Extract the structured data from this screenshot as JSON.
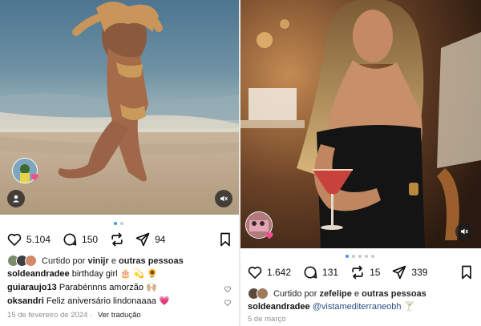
{
  "left_post": {
    "counts": {
      "likes": "5.104",
      "comments": "150",
      "shares": "94"
    },
    "liked_by": {
      "prefix": "Curtido por",
      "user": "vinijr",
      "conj": "e",
      "others": "outras pessoas"
    },
    "caption": {
      "user": "soldeandradee",
      "text": "birthday girl 🎂 💫 🌻"
    },
    "comments": [
      {
        "user": "guiaraujo13",
        "text": "Parabénnns amorzão 🙌🏼"
      },
      {
        "user": "oksandri",
        "text": "Feliz aniversário lindonaaaa 💗"
      }
    ],
    "date": "15 de fevereiro de 2024",
    "separator": "·",
    "translate": "Ver tradução"
  },
  "right_post": {
    "counts": {
      "likes": "1.642",
      "comments": "131",
      "reposts": "15",
      "shares": "339"
    },
    "liked_by": {
      "prefix": "Curtido por",
      "user": "zefelipe",
      "conj": "e",
      "others": "outras pessoas"
    },
    "caption": {
      "user": "soldeandradee",
      "mention": "@vistamediterraneobh",
      "emoji": "🍸"
    },
    "date": "5 de março"
  },
  "colors": {
    "accent_blue": "#3897f0",
    "mention": "#2b4f85",
    "meta_gray": "#8e8e8e"
  },
  "icons": [
    "heart-icon",
    "comment-icon",
    "repost-icon",
    "share-icon",
    "bookmark-icon",
    "mute-icon",
    "user-tag-icon"
  ]
}
